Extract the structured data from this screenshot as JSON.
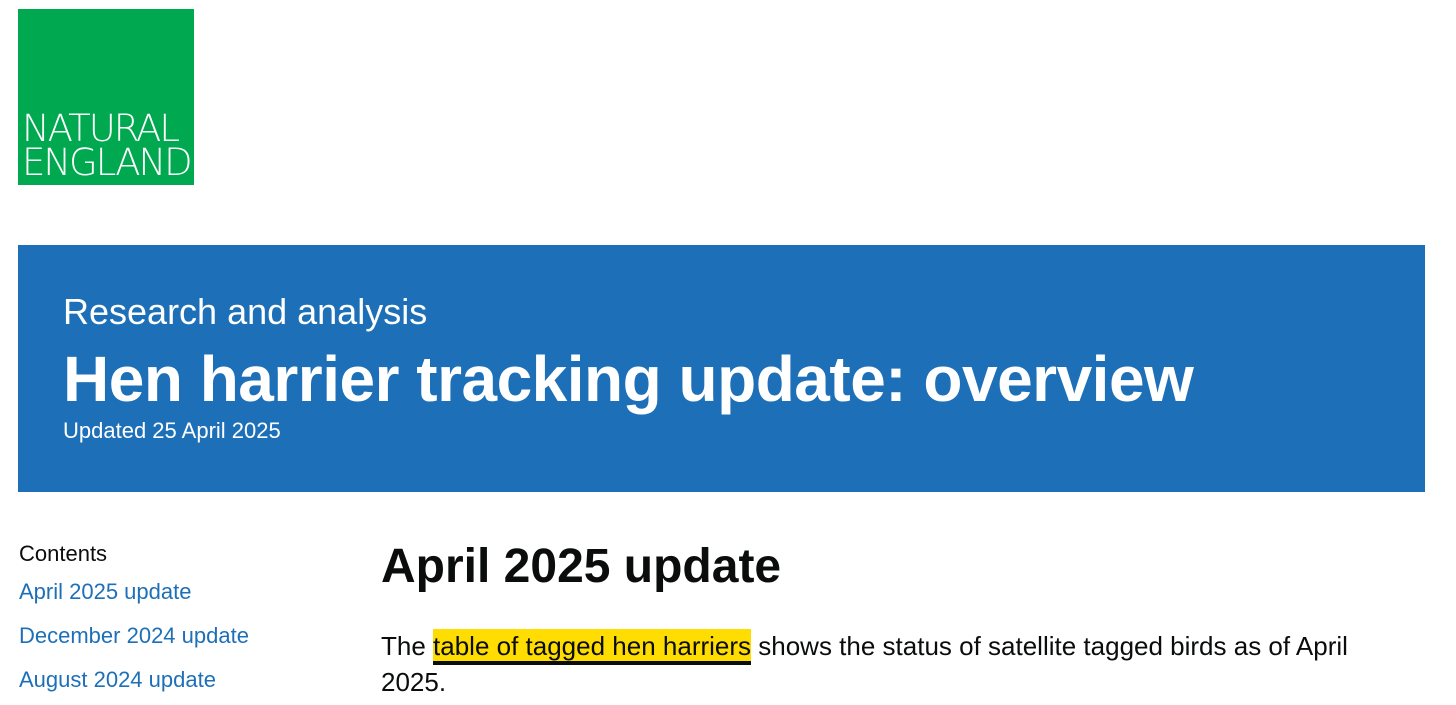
{
  "logo": {
    "text": "NATURAL\nENGLAND",
    "bg_color": "#00a94f"
  },
  "banner": {
    "document_type": "Research and analysis",
    "title": "Hen harrier tracking update: overview",
    "updated": "Updated 25 April 2025",
    "bg_color": "#1d70b8"
  },
  "contents": {
    "heading": "Contents",
    "items": [
      {
        "label": "April 2025 update"
      },
      {
        "label": "December 2024 update"
      },
      {
        "label": "August 2024 update"
      }
    ],
    "link_color": "#1d70b8"
  },
  "main": {
    "heading": "April 2025 update",
    "paragraph": {
      "before": "The ",
      "link": "table of tagged hen harriers",
      "after": " shows the status of satellite tagged birds as of April 2025."
    },
    "focus_color": "#ffdd00"
  }
}
